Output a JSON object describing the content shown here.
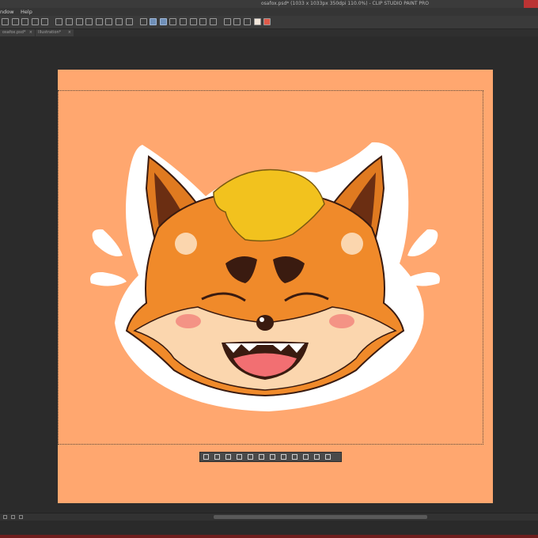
{
  "window": {
    "title": "osafox.psd* (1033 x 1033px 350dpi 110.0%) - CLIP STUDIO PAINT PRO"
  },
  "menu": {
    "items": [
      "ndow",
      "Help"
    ]
  },
  "tabs": [
    {
      "label": "osafox.psd*",
      "close": "×"
    },
    {
      "label": "Illustration*",
      "close": "×"
    }
  ],
  "colors": {
    "canvas": "#ffa76f",
    "fur_orange": "#f08a2a",
    "fur_cream": "#fbd6ae",
    "hair_yellow": "#f2c21e",
    "mouth_pink": "#f26f72",
    "outline": "#3a1b10",
    "sticker_border": "#ffffff"
  },
  "toolbar": {
    "icons": [
      "new-icon",
      "open-icon",
      "save-icon",
      "undo-icon",
      "redo-icon",
      "transform-icon",
      "select-all-icon",
      "deselect-icon",
      "invert-selection-icon",
      "expand-selection-icon",
      "shrink-selection-icon",
      "lasso-icon",
      "crop-icon",
      "fill-icon",
      "pen-icon",
      "brush-icon",
      "eraser-icon",
      "ruler-icon",
      "layer-icon",
      "copy-icon",
      "paste-icon",
      "grid-icon",
      "zoom-icon",
      "rotate-icon",
      "main-color-icon",
      "sub-color-icon"
    ]
  },
  "selection_launcher": {
    "icons": [
      "deselect-icon",
      "crop-icon",
      "clear-outside-icon",
      "clear-icon",
      "invert-icon",
      "expand-icon",
      "shrink-icon",
      "copy-paste-icon",
      "fill-icon",
      "transform-icon",
      "new-layer-icon",
      "settings-icon"
    ]
  }
}
